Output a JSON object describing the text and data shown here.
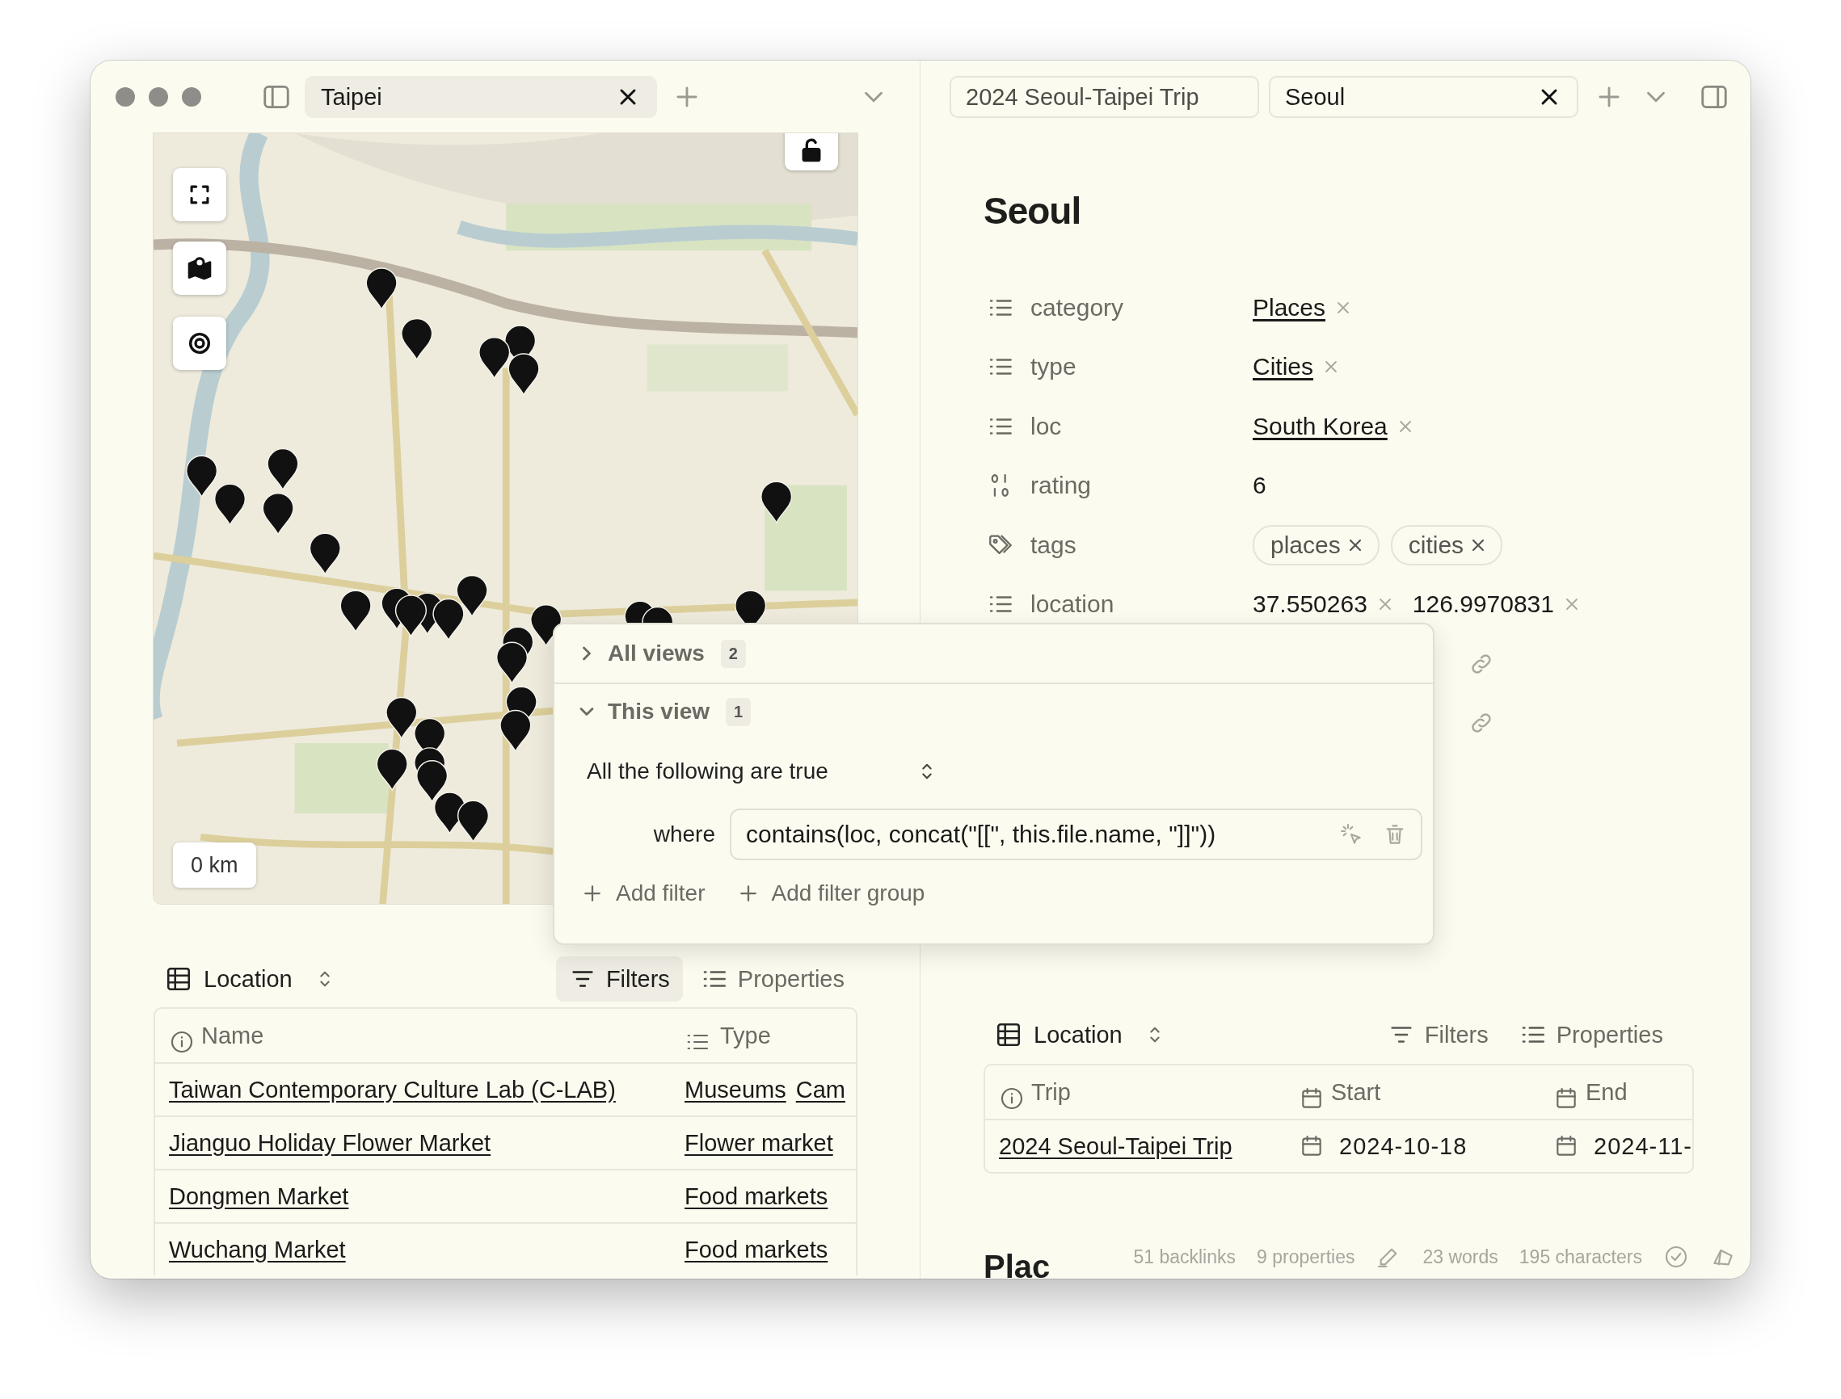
{
  "left_pane": {
    "focused": true,
    "tabs": [
      {
        "title": "Taipei",
        "selected": true
      }
    ],
    "map": {
      "scale": "0 km",
      "locked": false
    },
    "toolbar": {
      "view": "Location",
      "actions": [
        {
          "kind": "filters",
          "label": "Filters",
          "selected": true
        },
        {
          "kind": "properties",
          "label": "Properties",
          "selected": false
        }
      ]
    },
    "table": {
      "columns": [
        {
          "kind": "name",
          "label": "Name"
        },
        {
          "kind": "list",
          "label": "Type"
        }
      ],
      "rows": [
        {
          "name": "Taiwan Contemporary Culture Lab (C-LAB)",
          "type": [
            "Museums",
            "Cam"
          ]
        },
        {
          "name": "Jianguo Holiday Flower Market",
          "type": [
            "Flower market"
          ]
        },
        {
          "name": "Dongmen Market",
          "type": [
            "Food markets"
          ]
        },
        {
          "name": "Wuchang Market",
          "type": [
            "Food markets"
          ]
        }
      ]
    }
  },
  "right_pane": {
    "focused": false,
    "tabs": [
      {
        "title": "2024 Seoul-Taipei Trip",
        "selected": false
      },
      {
        "title": "Seoul",
        "selected": true
      }
    ],
    "note": {
      "title": "Seoul",
      "properties": [
        {
          "kind": "links",
          "key": "category",
          "values": [
            "Places"
          ]
        },
        {
          "kind": "links",
          "key": "type",
          "values": [
            "Cities"
          ]
        },
        {
          "kind": "links",
          "key": "loc",
          "values": [
            "South Korea"
          ]
        },
        {
          "kind": "number",
          "key": "rating",
          "values": [
            "6"
          ]
        },
        {
          "kind": "tags",
          "key": "tags",
          "values": [
            "places",
            "cities"
          ]
        },
        {
          "kind": "list",
          "key": "location",
          "values": [
            "37.550263",
            "126.9970831"
          ]
        },
        {
          "kind": "covered"
        },
        {
          "kind": "covered"
        }
      ],
      "toolbar": {
        "view": "Location",
        "actions": [
          {
            "kind": "filters",
            "label": "Filters",
            "selected": false
          },
          {
            "kind": "properties",
            "label": "Properties",
            "selected": false
          }
        ]
      },
      "table": {
        "columns": [
          {
            "kind": "name",
            "label": "Trip"
          },
          {
            "kind": "date",
            "label": "Start"
          },
          {
            "kind": "date",
            "label": "End"
          }
        ],
        "rows": [
          {
            "cells": [
              "2024 Seoul-Taipei Trip",
              "2024-10-18",
              "2024-11-"
            ]
          }
        ]
      },
      "next_heading": "Plac"
    },
    "status_bar": [
      {
        "kind": "text",
        "text": "51 backlinks"
      },
      {
        "kind": "text",
        "text": "9 properties"
      },
      {
        "kind": "mode"
      },
      {
        "kind": "text",
        "text": "23 words"
      },
      {
        "kind": "text",
        "text": "195 characters"
      },
      {
        "kind": "sync"
      },
      {
        "kind": "extension"
      }
    ]
  },
  "filter_popup": {
    "groups": [
      {
        "label": "All views",
        "count": "2",
        "expanded": false
      },
      {
        "label": "This view",
        "count": "1",
        "expanded": true
      }
    ],
    "conjunction": "All the following are true",
    "filters": [
      {
        "prefix": "where",
        "expression": "contains(loc, concat(\"[[\", this.file.name, \"]]\"))"
      }
    ],
    "actions": [
      "Add filter",
      "Add filter group"
    ]
  }
}
